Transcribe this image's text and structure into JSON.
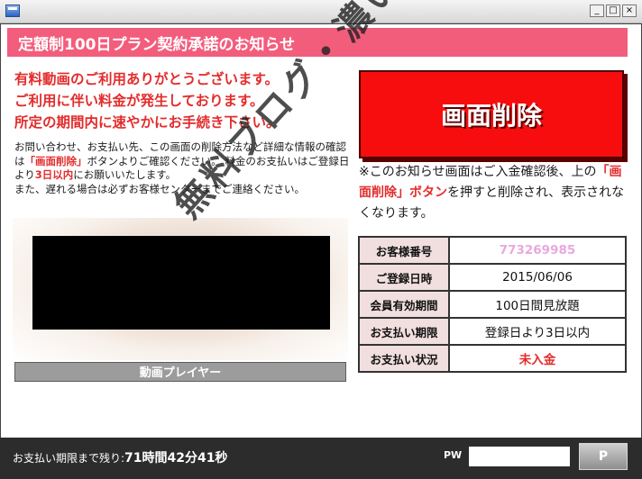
{
  "window": {
    "icon": "window-app-icon",
    "controls": {
      "minimize": "_",
      "maximize": "□",
      "close": "×"
    }
  },
  "header": {
    "title": "定額制100日プラン契約承諾のお知らせ"
  },
  "message": {
    "line1": "有料動画のご利用ありがとうございます。",
    "line2": "ご利用に伴い料金が発生しております。",
    "line3": "所定の期間内に速やかにお手続き下さい。"
  },
  "info": {
    "p1_a": "お問い合わせ、お支払い先、この画面の削除方法など詳細な情報の確認は",
    "p1_hl": "「画面削除」",
    "p1_b": "ボタンよりご確認ください。 料金のお支払いはご登録日より",
    "p1_hl2": "3日以内",
    "p1_c": "にお願いいたします。",
    "p2": "また、遅れる場合は必ずお客様センターまでご連絡ください。"
  },
  "delete_button": {
    "label": "画面削除"
  },
  "notice": {
    "a": "※このお知らせ画面はご入金確認後、上の",
    "hl": "「画面削除」ボタン",
    "b": "を押すと削除され、表示されなくなります。"
  },
  "player": {
    "label": "動画プレイヤー"
  },
  "customer_table": {
    "rows": [
      {
        "key": "お客様番号",
        "value": "773269985"
      },
      {
        "key": "ご登録日時",
        "value": "2015/06/06"
      },
      {
        "key": "会員有効期間",
        "value": "100日間見放題"
      },
      {
        "key": "お支払い期限",
        "value": "登録日より3日以内"
      },
      {
        "key": "お支払い状況",
        "value": "未入金"
      }
    ]
  },
  "watermark": {
    "text": "無料ブログ・濃いログ"
  },
  "footer": {
    "countdown_label": "お支払い期限まで残り:",
    "countdown_value": "71時間42分41秒",
    "pw_label": "PW",
    "pw_value": "",
    "p_button": "P"
  },
  "colors": {
    "header_bg": "#f35d7c",
    "accent_red": "#e32c2c",
    "delete_btn_bg": "#f70d0d",
    "footer_bg": "#2c2c2c",
    "table_key_bg": "#f1dfdf"
  }
}
